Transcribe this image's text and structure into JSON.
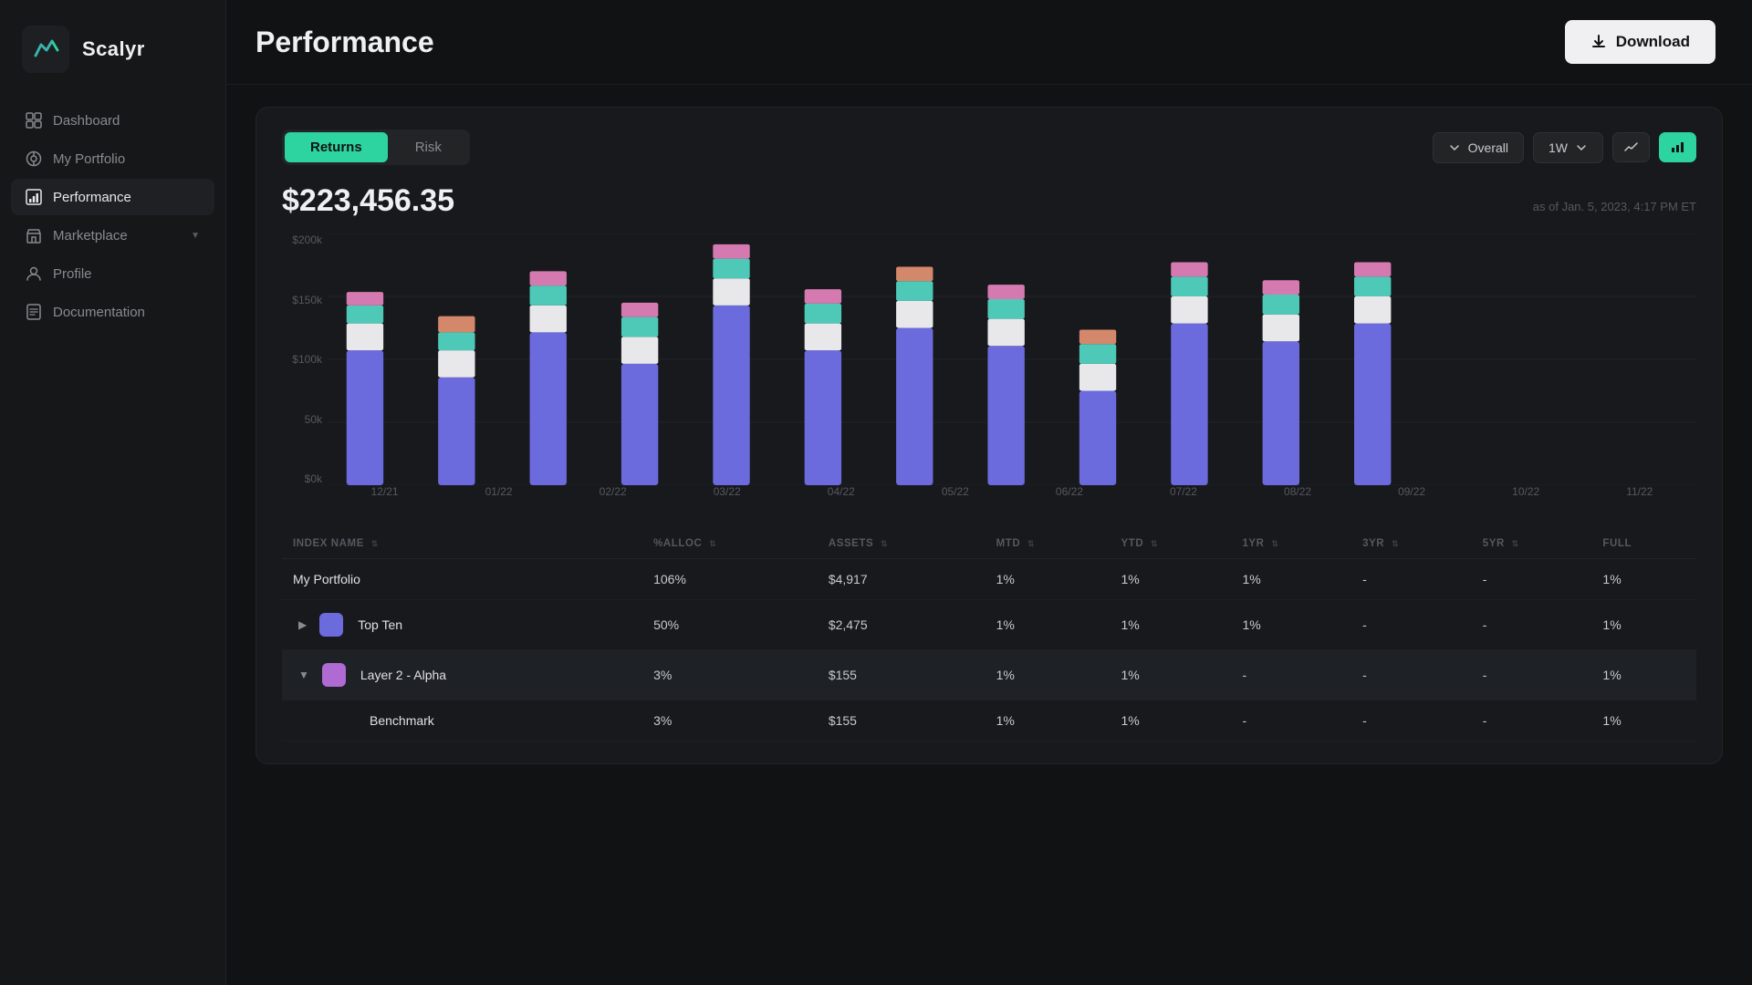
{
  "app": {
    "name": "Scalyr"
  },
  "sidebar": {
    "items": [
      {
        "id": "dashboard",
        "label": "Dashboard",
        "icon": "dashboard-icon",
        "active": false
      },
      {
        "id": "my-portfolio",
        "label": "My Portfolio",
        "icon": "portfolio-icon",
        "active": false
      },
      {
        "id": "performance",
        "label": "Performance",
        "icon": "performance-icon",
        "active": true
      },
      {
        "id": "marketplace",
        "label": "Marketplace",
        "icon": "marketplace-icon",
        "active": false,
        "hasChevron": true
      },
      {
        "id": "profile",
        "label": "Profile",
        "icon": "profile-icon",
        "active": false
      },
      {
        "id": "documentation",
        "label": "Documentation",
        "icon": "doc-icon",
        "active": false
      }
    ]
  },
  "header": {
    "title": "Performance",
    "download_label": "Download"
  },
  "chart_section": {
    "tab_returns": "Returns",
    "tab_risk": "Risk",
    "filter_overall": "Overall",
    "filter_period": "1W",
    "main_value": "$223,456.35",
    "as_of": "as of Jan. 5, 2023, 4:17 PM ET",
    "y_labels": [
      "$200k",
      "$150k",
      "$100k",
      "50k",
      "$0k"
    ],
    "x_labels": [
      "12/21",
      "01/22",
      "02/22",
      "03/22",
      "04/22",
      "05/22",
      "06/22",
      "07/22",
      "08/22",
      "09/22",
      "10/22",
      "11/22"
    ]
  },
  "table": {
    "columns": [
      {
        "key": "index_name",
        "label": "INDEX NAME",
        "sortable": true
      },
      {
        "key": "alloc",
        "label": "%ALLOC",
        "sortable": true
      },
      {
        "key": "assets",
        "label": "ASSETS",
        "sortable": true
      },
      {
        "key": "mtd",
        "label": "MTD",
        "sortable": true
      },
      {
        "key": "ytd",
        "label": "YTD",
        "sortable": true
      },
      {
        "key": "yr1",
        "label": "1YR",
        "sortable": true
      },
      {
        "key": "yr3",
        "label": "3YR",
        "sortable": true
      },
      {
        "key": "yr5",
        "label": "5YR",
        "sortable": true
      },
      {
        "key": "full",
        "label": "FULL",
        "sortable": false
      }
    ],
    "rows": [
      {
        "name": "My Portfolio",
        "alloc": "106%",
        "assets": "$4,917",
        "mtd": "1%",
        "ytd": "1%",
        "yr1": "1%",
        "yr3": "-",
        "yr5": "-",
        "full": "1%",
        "expanded": null,
        "color": null,
        "indent": 0
      },
      {
        "name": "Top Ten",
        "alloc": "50%",
        "assets": "$2,475",
        "mtd": "1%",
        "ytd": "1%",
        "yr1": "1%",
        "yr3": "-",
        "yr5": "-",
        "full": "1%",
        "expanded": false,
        "color": "#6b6bde",
        "indent": 0
      },
      {
        "name": "Layer 2 - Alpha",
        "alloc": "3%",
        "assets": "$155",
        "mtd": "1%",
        "ytd": "1%",
        "yr1": "-",
        "yr3": "-",
        "yr5": "-",
        "full": "1%",
        "expanded": true,
        "color": "#b06ad4",
        "indent": 0,
        "highlighted": true
      },
      {
        "name": "Benchmark",
        "alloc": "3%",
        "assets": "$155",
        "mtd": "1%",
        "ytd": "1%",
        "yr1": "-",
        "yr3": "-",
        "yr5": "-",
        "full": "1%",
        "expanded": null,
        "color": null,
        "indent": 1
      }
    ]
  },
  "colors": {
    "accent": "#2dd4a0",
    "bar_purple": "#6b6bde",
    "bar_teal": "#4ec9b8",
    "bar_pink": "#d47ab0",
    "bar_white": "#e8e8ea",
    "bar_salmon": "#d4886b"
  }
}
